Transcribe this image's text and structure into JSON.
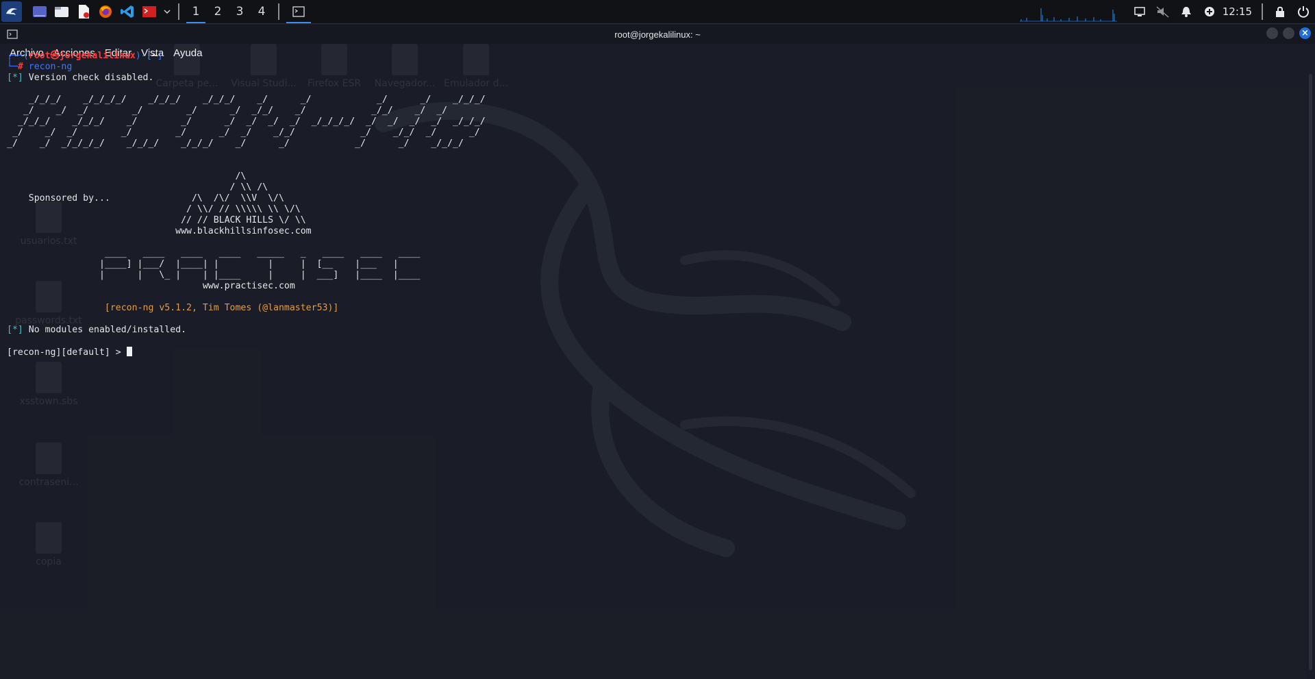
{
  "panel": {
    "workspaces": [
      "1",
      "2",
      "3",
      "4"
    ],
    "active_workspace": 0,
    "clock": "12:15",
    "icons": [
      "kali-menu-icon",
      "desktop-icon",
      "file-manager-icon",
      "text-editor-icon",
      "firefox-icon",
      "vscode-icon",
      "terminal-red-icon",
      "dropdown-chevron-icon"
    ],
    "tray_icons": [
      "display-icon",
      "volume-muted-icon",
      "bell-icon",
      "vpn-icon",
      "lock-icon",
      "power-icon"
    ]
  },
  "desktop": {
    "icons": [
      {
        "label": "Carpeta pe..."
      },
      {
        "label": "Visual Studi..."
      },
      {
        "label": "Firefox ESR"
      },
      {
        "label": "Navegador..."
      },
      {
        "label": "Emulador d..."
      },
      {
        "label": "usuarios.txt"
      },
      {
        "label": "passwords.txt"
      },
      {
        "label": "xsstown.sbs"
      },
      {
        "label": "contraseni..."
      },
      {
        "label": "copia"
      }
    ]
  },
  "window": {
    "title": "root@jorgekalilinux: ~",
    "menu": [
      "Archivo",
      "Acciones",
      "Editar",
      "Vista",
      "Ayuda"
    ]
  },
  "terminal": {
    "prompt_user": "root㉿jorgekalilinux",
    "prompt_dir": "~",
    "command": "recon-ng",
    "line_version": "Version check disabled.",
    "ascii_banner": [
      "    _/_/_/    _/_/_/_/    _/_/_/    _/_/_/    _/      _/            _/      _/    _/_/_/",
      "   _/    _/  _/        _/        _/      _/  _/_/    _/            _/_/    _/  _/",
      "  _/_/_/    _/_/_/    _/        _/      _/  _/  _/  _/  _/_/_/_/  _/  _/  _/  _/  _/_/_/",
      " _/    _/  _/        _/        _/      _/  _/    _/_/            _/    _/_/  _/      _/",
      "_/    _/  _/_/_/_/    _/_/_/    _/_/_/    _/      _/            _/      _/    _/_/_/"
    ],
    "sponsor_art": [
      "                                          /\\",
      "                                         / \\\\ /\\",
      "    Sponsored by...               /\\  /\\/  \\\\V  \\/\\",
      "                                 / \\\\/ // \\\\\\\\\\ \\\\ \\/\\",
      "                                // // BLACK HILLS \\/ \\\\",
      "                               www.blackhillsinfosec.com"
    ],
    "practisec_art": [
      "                  ____   ____   ____   ____   _____   _   ____   ____   ____",
      "                 |____] |___/  |____| |         |     |  [__    |___   |",
      "                 |      |   \\_ |    | |____     |     |  ___]   |____  |____",
      "                                    www.practisec.com"
    ],
    "version_line": "[recon-ng v5.1.2, Tim Tomes (@lanmaster53)]",
    "modules_line": "No modules enabled/installed.",
    "repl_prompt": "[recon-ng][default] > "
  }
}
